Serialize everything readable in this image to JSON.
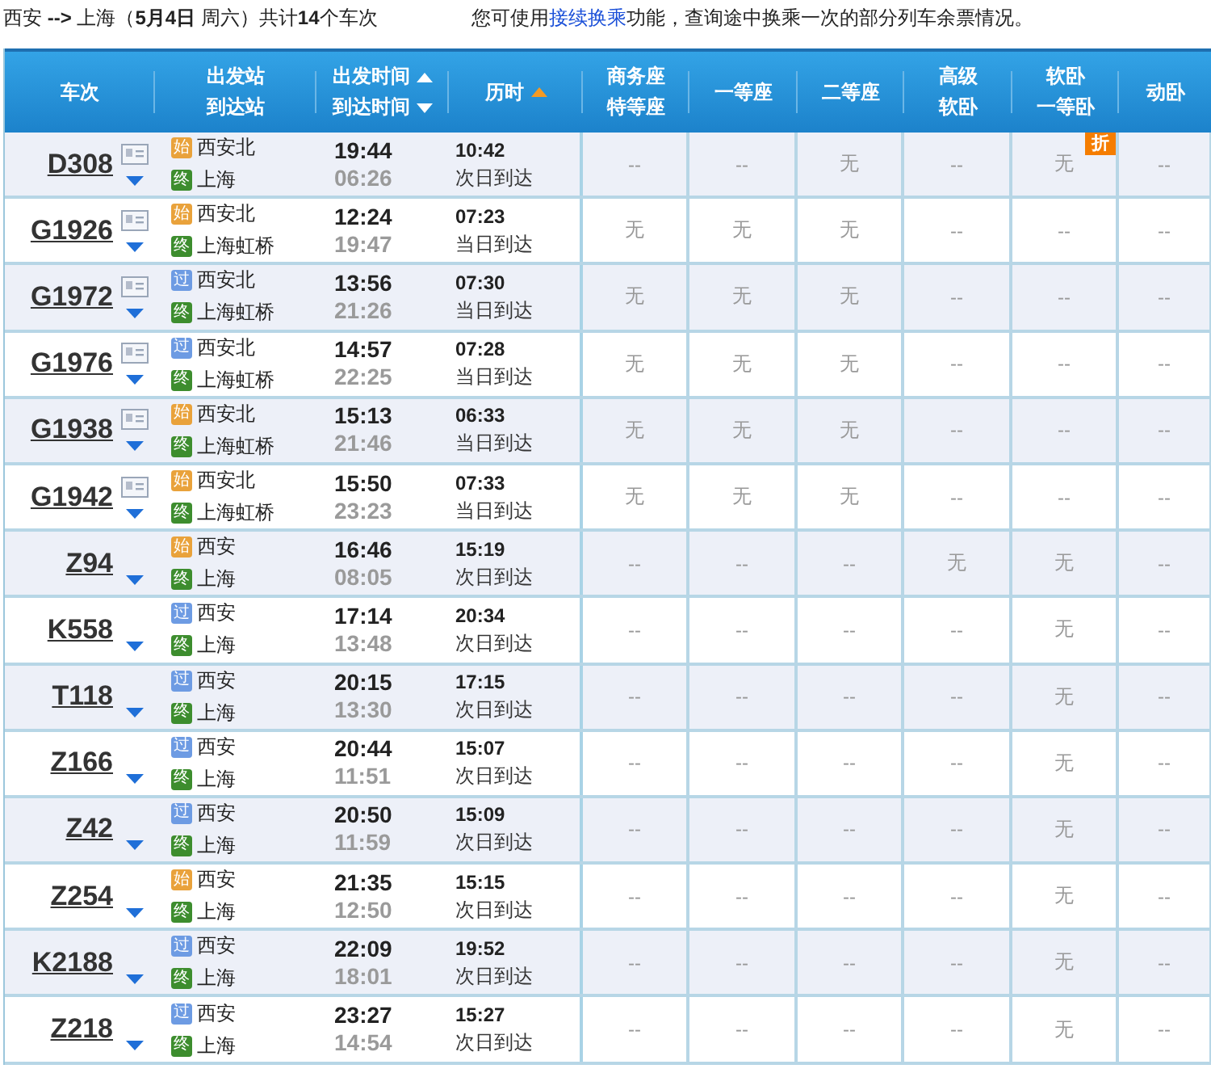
{
  "summary": {
    "route": "西安 **-->** 上海（**5月4日**  周六）共计**14**个车次",
    "hint_before": "您可使用",
    "hint_link": "接续换乘",
    "hint_after": "功能，查询途中换乘一次的部分列车余票情况。"
  },
  "header": {
    "columns": [
      {
        "lines": [
          {
            "text": "车次"
          }
        ]
      },
      {
        "lines": [
          {
            "text": "出发站"
          },
          {
            "text": "到达站"
          }
        ]
      },
      {
        "lines": [
          {
            "text": "出发时间",
            "sort_ascending": true,
            "active": false
          },
          {
            "text": "到达时间",
            "sort_ascending": false,
            "active": false
          }
        ]
      },
      {
        "lines": [
          {
            "text": "历时",
            "sort_ascending": true,
            "active": true
          }
        ]
      },
      {
        "lines": [
          {
            "text": "商务座"
          },
          {
            "text": "特等座"
          }
        ]
      },
      {
        "lines": [
          {
            "text": "一等座"
          }
        ]
      },
      {
        "lines": [
          {
            "text": "二等座"
          }
        ]
      },
      {
        "lines": [
          {
            "text": "高级"
          },
          {
            "text": "软卧"
          }
        ]
      },
      {
        "lines": [
          {
            "text": "软卧"
          },
          {
            "text": "一等卧"
          }
        ]
      },
      {
        "lines": [
          {
            "text": "动卧"
          }
        ]
      }
    ]
  },
  "rows": [
    {
      "train": "D308",
      "info_card": true,
      "from": {
        "kind": "start",
        "badge": "始",
        "name": "西安北"
      },
      "to": {
        "kind": "end",
        "badge": "终",
        "name": "上海"
      },
      "depart": "19:44",
      "arrive": "06:26",
      "duration": "10:42",
      "arrival_day": "次日到达",
      "seats": [
        "--",
        "--",
        "无",
        "--",
        {
          "text": "无",
          "tag": "折"
        },
        "--"
      ]
    },
    {
      "train": "G1926",
      "info_card": true,
      "from": {
        "kind": "start",
        "badge": "始",
        "name": "西安北"
      },
      "to": {
        "kind": "end",
        "badge": "终",
        "name": "上海虹桥"
      },
      "depart": "12:24",
      "arrive": "19:47",
      "duration": "07:23",
      "arrival_day": "当日到达",
      "seats": [
        "无",
        "无",
        "无",
        "--",
        "--",
        "--"
      ]
    },
    {
      "train": "G1972",
      "info_card": true,
      "from": {
        "kind": "pass",
        "badge": "过",
        "name": "西安北"
      },
      "to": {
        "kind": "end",
        "badge": "终",
        "name": "上海虹桥"
      },
      "depart": "13:56",
      "arrive": "21:26",
      "duration": "07:30",
      "arrival_day": "当日到达",
      "seats": [
        "无",
        "无",
        "无",
        "--",
        "--",
        "--"
      ]
    },
    {
      "train": "G1976",
      "info_card": true,
      "from": {
        "kind": "pass",
        "badge": "过",
        "name": "西安北"
      },
      "to": {
        "kind": "end",
        "badge": "终",
        "name": "上海虹桥"
      },
      "depart": "14:57",
      "arrive": "22:25",
      "duration": "07:28",
      "arrival_day": "当日到达",
      "seats": [
        "无",
        "无",
        "无",
        "--",
        "--",
        "--"
      ]
    },
    {
      "train": "G1938",
      "info_card": true,
      "from": {
        "kind": "start",
        "badge": "始",
        "name": "西安北"
      },
      "to": {
        "kind": "end",
        "badge": "终",
        "name": "上海虹桥"
      },
      "depart": "15:13",
      "arrive": "21:46",
      "duration": "06:33",
      "arrival_day": "当日到达",
      "seats": [
        "无",
        "无",
        "无",
        "--",
        "--",
        "--"
      ]
    },
    {
      "train": "G1942",
      "info_card": true,
      "from": {
        "kind": "start",
        "badge": "始",
        "name": "西安北"
      },
      "to": {
        "kind": "end",
        "badge": "终",
        "name": "上海虹桥"
      },
      "depart": "15:50",
      "arrive": "23:23",
      "duration": "07:33",
      "arrival_day": "当日到达",
      "seats": [
        "无",
        "无",
        "无",
        "--",
        "--",
        "--"
      ]
    },
    {
      "train": "Z94",
      "info_card": false,
      "from": {
        "kind": "start",
        "badge": "始",
        "name": "西安"
      },
      "to": {
        "kind": "end",
        "badge": "终",
        "name": "上海"
      },
      "depart": "16:46",
      "arrive": "08:05",
      "duration": "15:19",
      "arrival_day": "次日到达",
      "seats": [
        "--",
        "--",
        "--",
        "无",
        "无",
        "--"
      ]
    },
    {
      "train": "K558",
      "info_card": false,
      "from": {
        "kind": "pass",
        "badge": "过",
        "name": "西安"
      },
      "to": {
        "kind": "end",
        "badge": "终",
        "name": "上海"
      },
      "depart": "17:14",
      "arrive": "13:48",
      "duration": "20:34",
      "arrival_day": "次日到达",
      "seats": [
        "--",
        "--",
        "--",
        "--",
        "无",
        "--"
      ]
    },
    {
      "train": "T118",
      "info_card": false,
      "from": {
        "kind": "pass",
        "badge": "过",
        "name": "西安"
      },
      "to": {
        "kind": "end",
        "badge": "终",
        "name": "上海"
      },
      "depart": "20:15",
      "arrive": "13:30",
      "duration": "17:15",
      "arrival_day": "次日到达",
      "seats": [
        "--",
        "--",
        "--",
        "--",
        "无",
        "--"
      ]
    },
    {
      "train": "Z166",
      "info_card": false,
      "from": {
        "kind": "pass",
        "badge": "过",
        "name": "西安"
      },
      "to": {
        "kind": "end",
        "badge": "终",
        "name": "上海"
      },
      "depart": "20:44",
      "arrive": "11:51",
      "duration": "15:07",
      "arrival_day": "次日到达",
      "seats": [
        "--",
        "--",
        "--",
        "--",
        "无",
        "--"
      ]
    },
    {
      "train": "Z42",
      "info_card": false,
      "from": {
        "kind": "pass",
        "badge": "过",
        "name": "西安"
      },
      "to": {
        "kind": "end",
        "badge": "终",
        "name": "上海"
      },
      "depart": "20:50",
      "arrive": "11:59",
      "duration": "15:09",
      "arrival_day": "次日到达",
      "seats": [
        "--",
        "--",
        "--",
        "--",
        "无",
        "--"
      ]
    },
    {
      "train": "Z254",
      "info_card": false,
      "from": {
        "kind": "start",
        "badge": "始",
        "name": "西安"
      },
      "to": {
        "kind": "end",
        "badge": "终",
        "name": "上海"
      },
      "depart": "21:35",
      "arrive": "12:50",
      "duration": "15:15",
      "arrival_day": "次日到达",
      "seats": [
        "--",
        "--",
        "--",
        "--",
        "无",
        "--"
      ]
    },
    {
      "train": "K2188",
      "info_card": false,
      "from": {
        "kind": "pass",
        "badge": "过",
        "name": "西安"
      },
      "to": {
        "kind": "end",
        "badge": "终",
        "name": "上海"
      },
      "depart": "22:09",
      "arrive": "18:01",
      "duration": "19:52",
      "arrival_day": "次日到达",
      "seats": [
        "--",
        "--",
        "--",
        "--",
        "无",
        "--"
      ]
    },
    {
      "train": "Z218",
      "info_card": false,
      "from": {
        "kind": "pass",
        "badge": "过",
        "name": "西安"
      },
      "to": {
        "kind": "end",
        "badge": "终",
        "name": "上海"
      },
      "depart": "23:27",
      "arrive": "14:54",
      "duration": "15:27",
      "arrival_day": "次日到达",
      "seats": [
        "--",
        "--",
        "--",
        "--",
        "无",
        "--"
      ]
    }
  ]
}
